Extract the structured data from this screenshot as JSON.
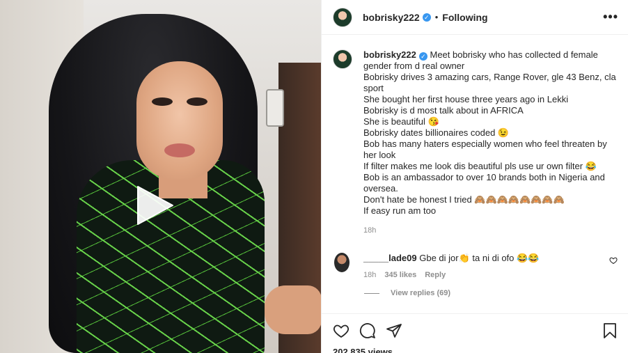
{
  "post": {
    "username": "bobrisky222",
    "verified_mark": "✓",
    "dot": "•",
    "follow_status": "Following",
    "more_label": "•••"
  },
  "caption": {
    "username": "bobrisky222",
    "lines": [
      "Meet bobrisky who has collected d female gender from d real owner",
      "Bobrisky drives 3 amazing cars, Range Rover, gle 43 Benz, cla sport",
      "She bought her first house three years ago in Lekki",
      "Bobrisky is d most talk about in AFRICA",
      "She is beautiful 😘",
      "Bobrisky dates billionaires coded 😉",
      "Bob has many haters especially women who feel threaten by her look",
      "If filter makes me look dis beautiful pls use ur own filter 😂",
      "Bob is an ambassador to over 10 brands both in Nigeria and oversea.",
      "Don't hate be honest I tried 🙈🙈🙈🙈🙈🙈🙈🙈",
      "If easy run am too"
    ],
    "time": "18h"
  },
  "comment": {
    "username": "_____lade09",
    "text": "Gbe di jor👏 ta ni di ofo 😂😂",
    "time": "18h",
    "likes": "345 likes",
    "reply": "Reply",
    "view_replies": "View replies (69)"
  },
  "actions": {
    "icons": [
      "heart-icon",
      "comment-icon",
      "share-icon",
      "bookmark-icon"
    ]
  },
  "views": "202,835 views",
  "colors": {
    "verified": "#3897f0",
    "text": "#262626",
    "muted": "#8e8e8e",
    "border": "#efefef"
  }
}
